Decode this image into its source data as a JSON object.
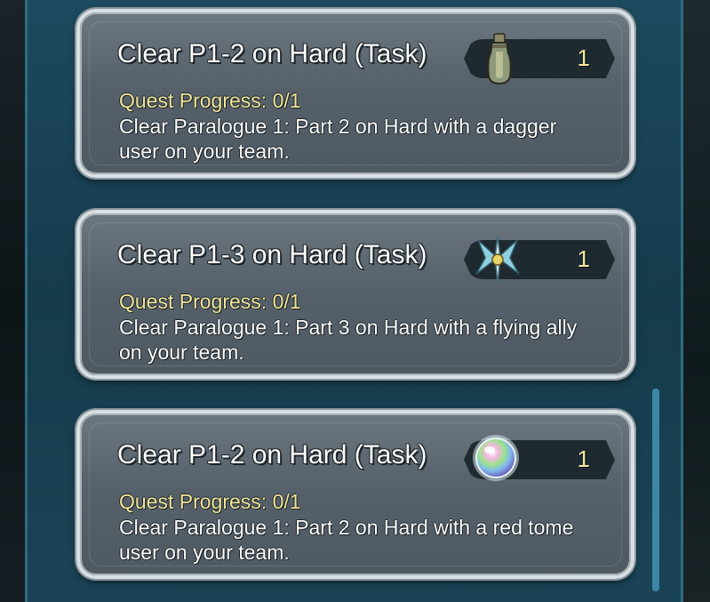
{
  "quests": [
    {
      "title": "Clear P1-2 on Hard (Task)",
      "progress": "Quest Progress: 0/1",
      "description": "Clear Paralogue 1: Part 2 on Hard with a dagger user on your team.",
      "reward_icon": "dagger-potion-icon",
      "reward_count": "1"
    },
    {
      "title": "Clear P1-3 on Hard (Task)",
      "progress": "Quest Progress: 0/1",
      "description": "Clear Paralogue 1: Part 3 on Hard with a flying ally on your team.",
      "reward_icon": "wings-emblem-icon",
      "reward_count": "1"
    },
    {
      "title": "Clear P1-2 on Hard (Task)",
      "progress": "Quest Progress: 0/1",
      "description": "Clear Paralogue 1: Part 2 on Hard with a red tome user on your team.",
      "reward_icon": "orb-icon",
      "reward_count": "1"
    }
  ],
  "colors": {
    "progress_text": "#f2e79a",
    "frame": "#1d4a5e",
    "card": "#5b6670"
  }
}
